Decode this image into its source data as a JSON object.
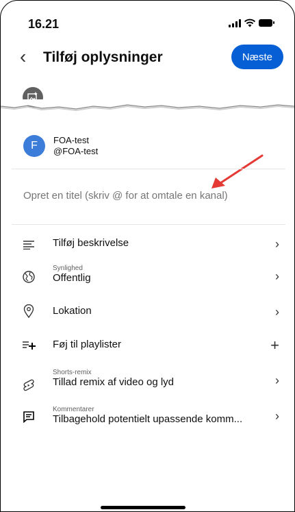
{
  "status_bar": {
    "time": "16.21"
  },
  "header": {
    "title": "Tilføj oplysninger",
    "next_label": "Næste"
  },
  "account": {
    "avatar_letter": "F",
    "name": "FOA-test",
    "handle": "@FOA-test"
  },
  "title_input": {
    "placeholder": "Opret en titel (skriv @ for at omtale en kanal)",
    "value": ""
  },
  "menu": [
    {
      "icon": "description-icon",
      "sublabel": "",
      "label": "Tilføj beskrivelse",
      "action": "chevron"
    },
    {
      "icon": "globe-icon",
      "sublabel": "Synlighed",
      "label": "Offentlig",
      "action": "chevron"
    },
    {
      "icon": "location-pin-icon",
      "sublabel": "",
      "label": "Lokation",
      "action": "chevron"
    },
    {
      "icon": "playlist-add-icon",
      "sublabel": "",
      "label": "Føj til playlister",
      "action": "plus"
    },
    {
      "icon": "shorts-remix-icon",
      "sublabel": "Shorts-remix",
      "label": "Tillad remix af video og lyd",
      "action": "chevron"
    },
    {
      "icon": "comment-icon",
      "sublabel": "Kommentarer",
      "label": "Tilbagehold potentielt upassende komm...",
      "action": "chevron"
    }
  ],
  "colors": {
    "accent": "#065fd4",
    "avatar": "#3b7dd8",
    "arrow": "#e53935"
  }
}
